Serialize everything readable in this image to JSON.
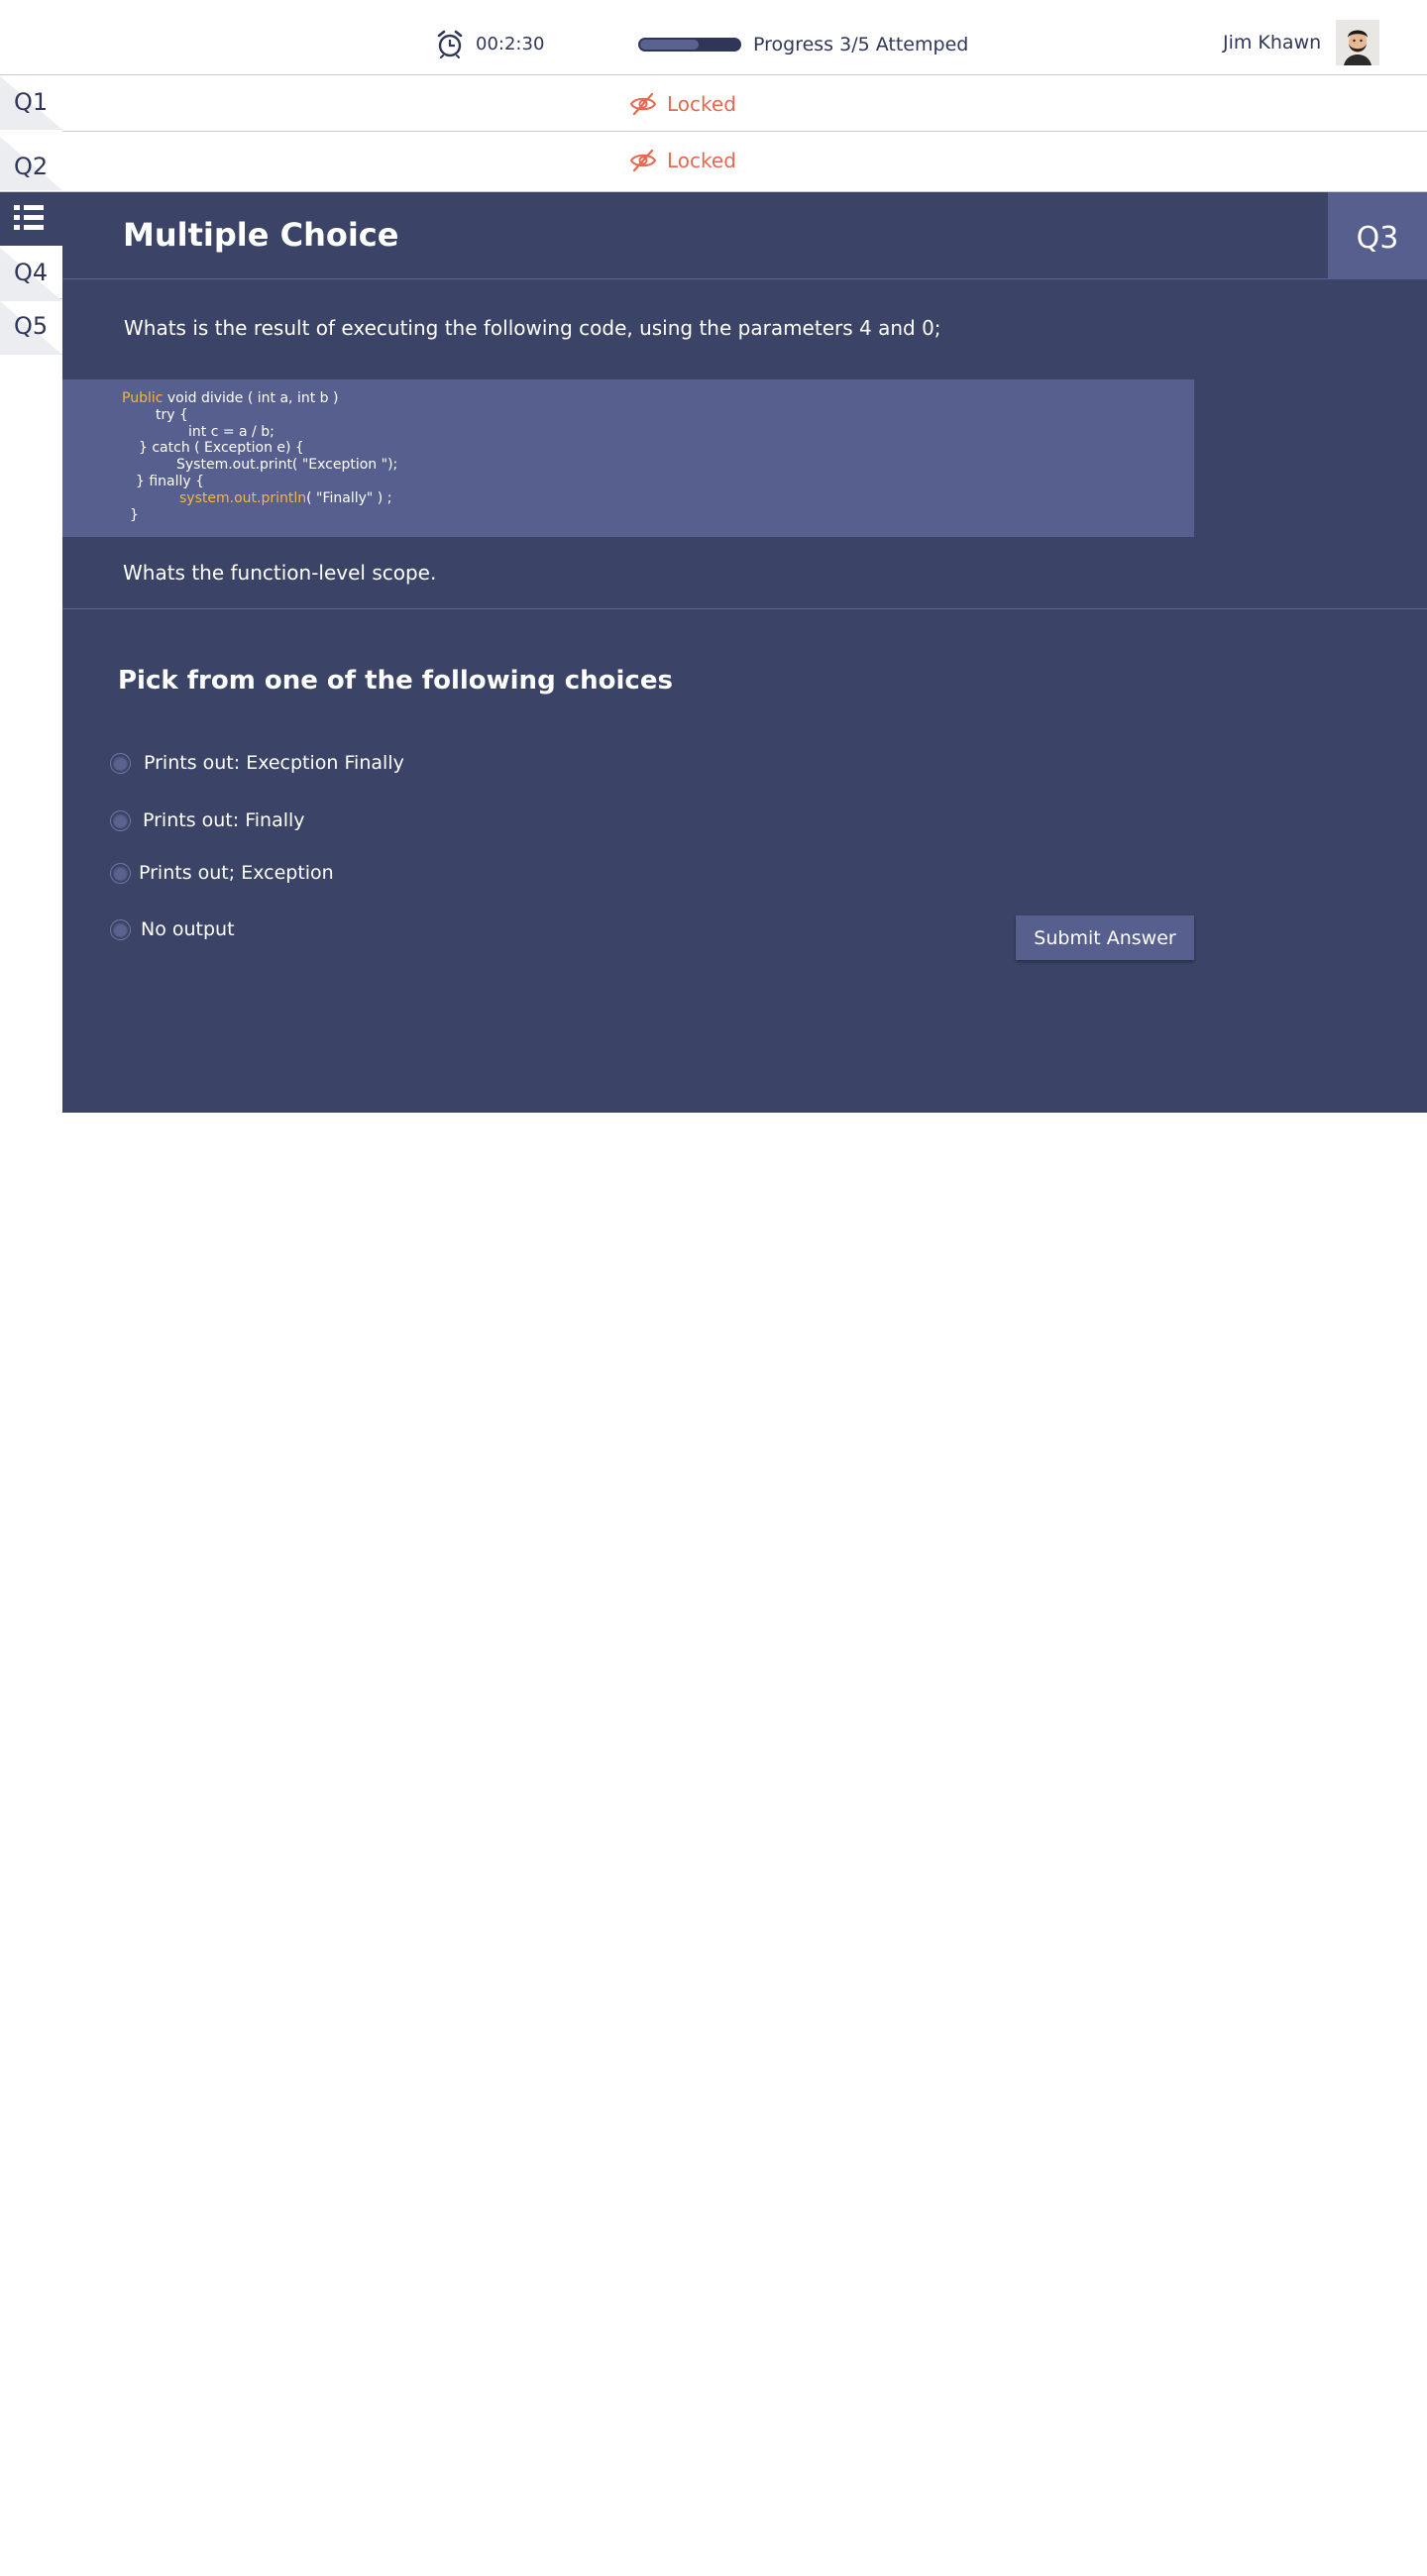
{
  "header": {
    "timer": "00:2:30",
    "progress_fraction": 0.57,
    "progress_label": "Progress 3/5 Attemped",
    "user_name": "Jim Khawn"
  },
  "sidebar": {
    "tabs": [
      {
        "label": "Q1"
      },
      {
        "label": "Q2"
      },
      {
        "label": "",
        "icon": "list-icon",
        "active": true
      },
      {
        "label": "Q4"
      },
      {
        "label": "Q5"
      }
    ]
  },
  "locked_rows": [
    {
      "label": "Locked",
      "icon": "eye-slash-icon"
    },
    {
      "label": "Locked",
      "icon": "eye-slash-icon"
    }
  ],
  "panel": {
    "title": "Multiple Choice",
    "question_number": "Q3",
    "question": "Whats is the result of executing the following code, using the parameters 4 and 0;",
    "code": {
      "line1_keyword": "Public",
      "line1_rest": " void divide ( int a, int b )",
      "line2": "try {",
      "line3": "int c = a / b;",
      "line4": "} catch ( Exception e) {",
      "line5": "System.out.print( \"Exception \");",
      "line6": "} finally {",
      "line7_keyword": "system.out.println",
      "line7_rest": "( \"Finally\" ) ;",
      "line8": "}"
    },
    "scope_text": "Whats the function-level scope.",
    "choices_title": "Pick from one of the following choices",
    "choices": [
      {
        "label": "Prints out: Execption Finally"
      },
      {
        "label": "Prints out: Finally"
      },
      {
        "label": "Prints out; Exception"
      },
      {
        "label": "No output"
      }
    ],
    "submit_label": "Submit Answer"
  },
  "colors": {
    "navy": "#3b4466",
    "panel_accent": "#565f8d",
    "locked": "#e8674f",
    "code_keyword": "#f5b642"
  }
}
